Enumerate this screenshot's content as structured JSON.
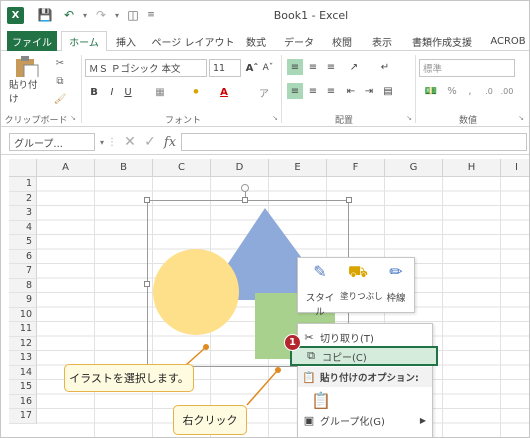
{
  "window": {
    "title": "Book1 - Excel"
  },
  "tabs": [
    "ファイル",
    "ホーム",
    "挿入",
    "ページ レイアウト",
    "数式",
    "データ",
    "校閲",
    "表示",
    "書類作成支援",
    "ACROB"
  ],
  "ribbon": {
    "clipboard": {
      "paste": "貼り付け",
      "label": "クリップボード"
    },
    "font": {
      "name": "ＭＳ Ｐゴシック 本文",
      "size": "11",
      "label": "フォント"
    },
    "align": {
      "label": "配置"
    },
    "number": {
      "format": "標準",
      "label": "数値"
    }
  },
  "formula_bar": {
    "name_box": "グループ..."
  },
  "columns": [
    "A",
    "B",
    "C",
    "D",
    "E",
    "F",
    "G",
    "H",
    "I"
  ],
  "rows": [
    "1",
    "2",
    "3",
    "4",
    "5",
    "6",
    "7",
    "8",
    "9",
    "10",
    "11",
    "12",
    "13",
    "14",
    "15",
    "16",
    "17"
  ],
  "mini_toolbar": {
    "style": "スタイル",
    "fill": "塗りつぶし",
    "outline": "枠線"
  },
  "context_menu": {
    "cut": "切り取り(T)",
    "copy": "コピー(C)",
    "paste_options": "貼り付けのオプション:",
    "group": "グループ化(G)"
  },
  "callouts": {
    "select": "イラストを選択します。",
    "right_click": "右クリック",
    "step": "1"
  },
  "colors": {
    "accent": "#217346",
    "circle": "#ffe08a",
    "triangle": "#8eaadb",
    "rect": "#a9d18e",
    "callout_border": "#e8b24a",
    "highlight": "#d5ecdc"
  }
}
